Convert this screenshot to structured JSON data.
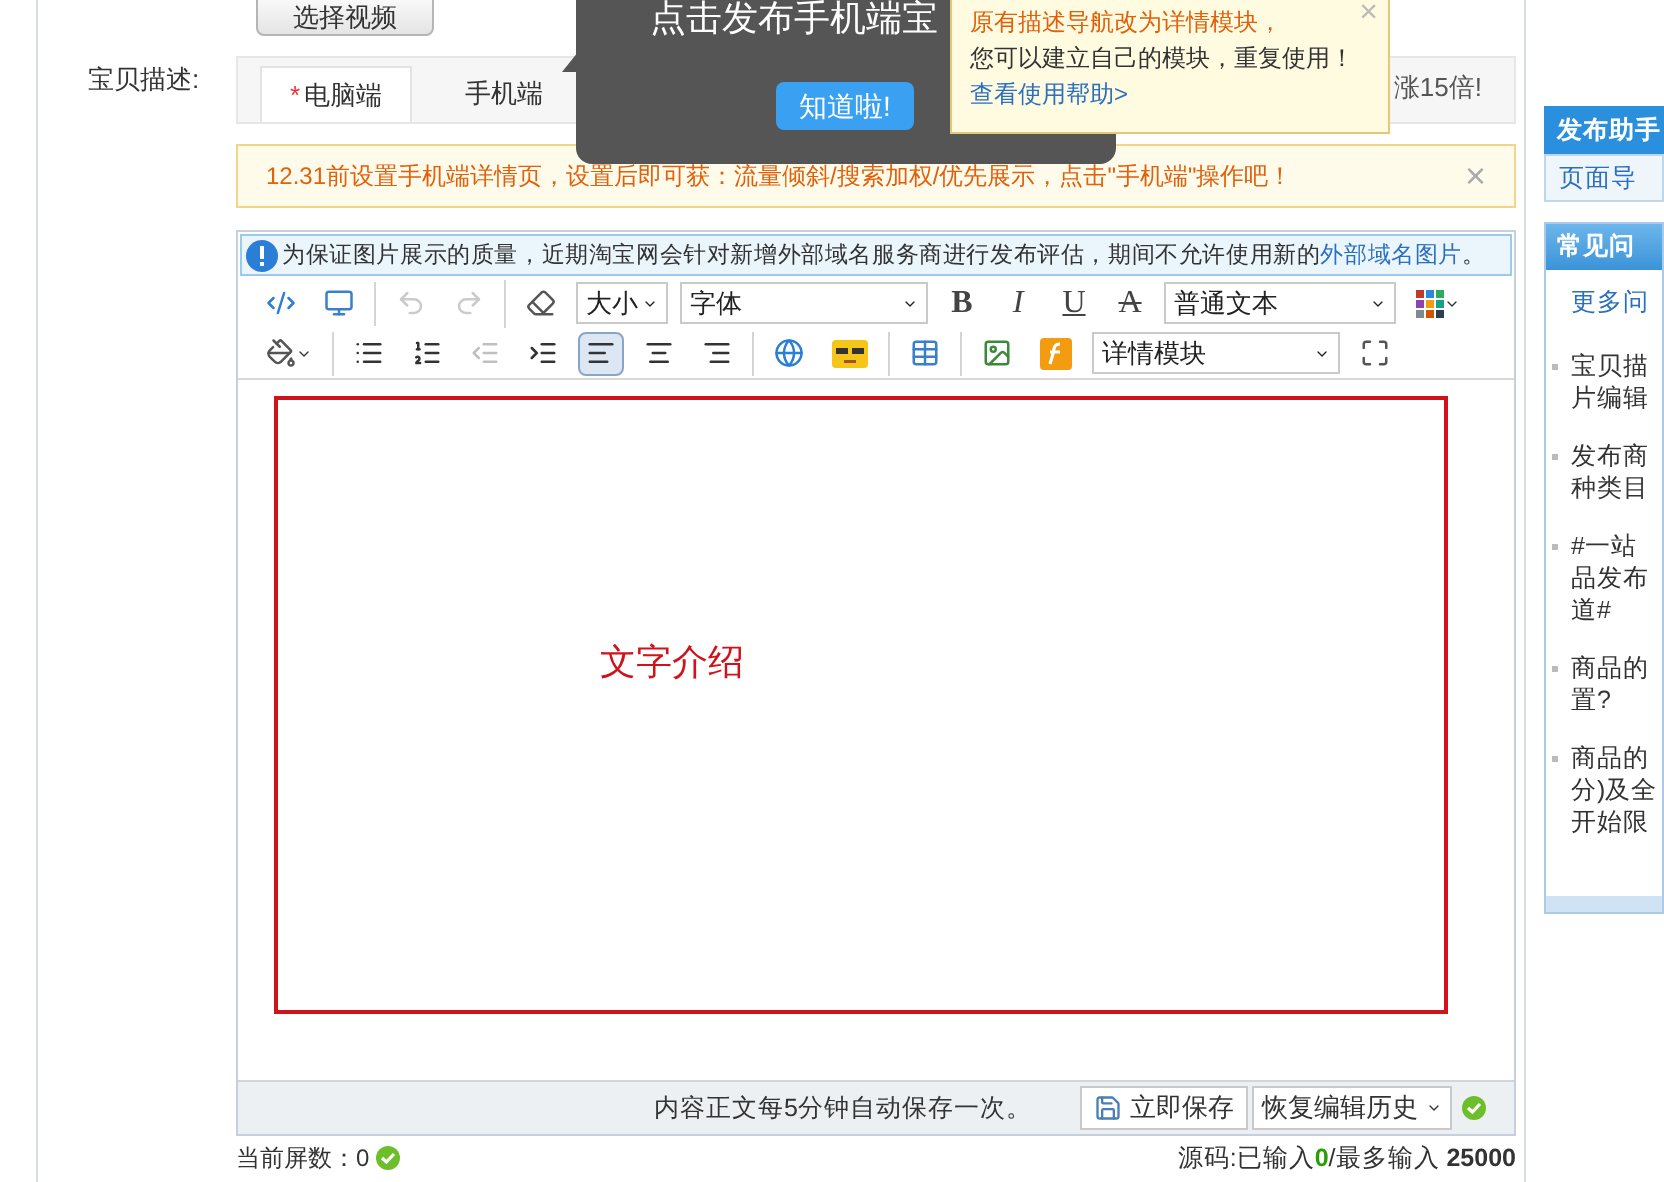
{
  "video_button": "选择视频",
  "description_label": "宝贝描述:",
  "tabs": [
    {
      "marker": "*",
      "label": "电脑端",
      "selected": true
    },
    {
      "label": "手机端",
      "selected": false
    }
  ],
  "tab_bar_promo": "涨15倍!",
  "guide_popover": {
    "text": "点击发布手机端宝",
    "button": "知道啦!"
  },
  "tip_popup": {
    "line_1": "原有描述导航改为详情模块，",
    "line_2": "您可以建立自己的模块，重复使用！",
    "link": "查看使用帮助>",
    "close": "×"
  },
  "notice": {
    "text": "12.31前设置手机端详情页，设置后即可获：流量倾斜/搜索加权/优先展示，点击\"手机端\"操作吧！",
    "close": "×"
  },
  "info_bar": {
    "text": "为保证图片展示的质量，近期淘宝网会针对新增外部域名服务商进行发布评估，期间不允许使用新的",
    "link": "外部域名图片",
    "end": "。"
  },
  "toolbar": {
    "row_1": [
      [
        {
          "kind": "icon",
          "disabled": false,
          "selected": false
        },
        {
          "kind": "icon",
          "disabled": false,
          "selected": false
        }
      ],
      [
        {
          "kind": "icon",
          "disabled": true,
          "selected": false
        },
        {
          "kind": "icon",
          "disabled": true,
          "selected": false
        }
      ],
      [
        {
          "kind": "icon",
          "disabled": false,
          "selected": false
        },
        {
          "kind": "select",
          "label": "大小"
        },
        {
          "kind": "select",
          "label": "字体"
        },
        {
          "kind": "glyph",
          "label": "B"
        },
        {
          "kind": "glyph",
          "label": "I"
        },
        {
          "kind": "glyph",
          "label": "U"
        },
        {
          "kind": "glyph",
          "label": "A"
        },
        {
          "kind": "select",
          "label": "普通文本"
        },
        {
          "kind": "icon",
          "disabled": false,
          "selected": false
        }
      ]
    ],
    "row_2": [
      [
        {
          "kind": "icon",
          "disabled": false,
          "selected": false
        }
      ],
      [
        {
          "kind": "icon",
          "disabled": false,
          "selected": false
        },
        {
          "kind": "icon",
          "disabled": false,
          "selected": false
        },
        {
          "kind": "icon",
          "disabled": true,
          "selected": false
        },
        {
          "kind": "icon",
          "disabled": false,
          "selected": false
        },
        {
          "kind": "icon",
          "disabled": false,
          "selected": true
        },
        {
          "kind": "icon",
          "disabled": false,
          "selected": false
        },
        {
          "kind": "icon",
          "disabled": false,
          "selected": false
        }
      ],
      [
        {
          "kind": "icon",
          "disabled": false,
          "selected": false
        },
        {
          "kind": "icon",
          "disabled": false,
          "selected": false
        }
      ],
      [
        {
          "kind": "icon",
          "disabled": false,
          "selected": false
        }
      ],
      [
        {
          "kind": "icon",
          "disabled": false,
          "selected": false
        },
        {
          "kind": "icon",
          "disabled": false,
          "selected": false
        },
        {
          "kind": "select",
          "label": "详情模块"
        },
        {
          "kind": "icon",
          "disabled": false,
          "selected": false
        }
      ]
    ]
  },
  "editor_content": "文字介绍",
  "footer": {
    "autosave_note": "内容正文每5分钟自动保存一次。",
    "save_button": "立即保存",
    "history_select": "恢复编辑历史"
  },
  "screen_count": "当前屏数：0",
  "source_count": "源码:已输入**0**/最多输入 **25000**",
  "sidebar": {
    "assistant_title": "发布助手",
    "page_nav": "页面导",
    "faq_title": "常见问",
    "more": "更多问",
    "faq_items": [
      [
        "宝贝描",
        "片编辑"
      ],
      [
        "发布商",
        "种类目"
      ],
      [
        "#一站",
        "品发布",
        "道#"
      ],
      [
        "商品的",
        "置?"
      ],
      [
        "商品的",
        "分)及全",
        "开始限"
      ]
    ]
  }
}
